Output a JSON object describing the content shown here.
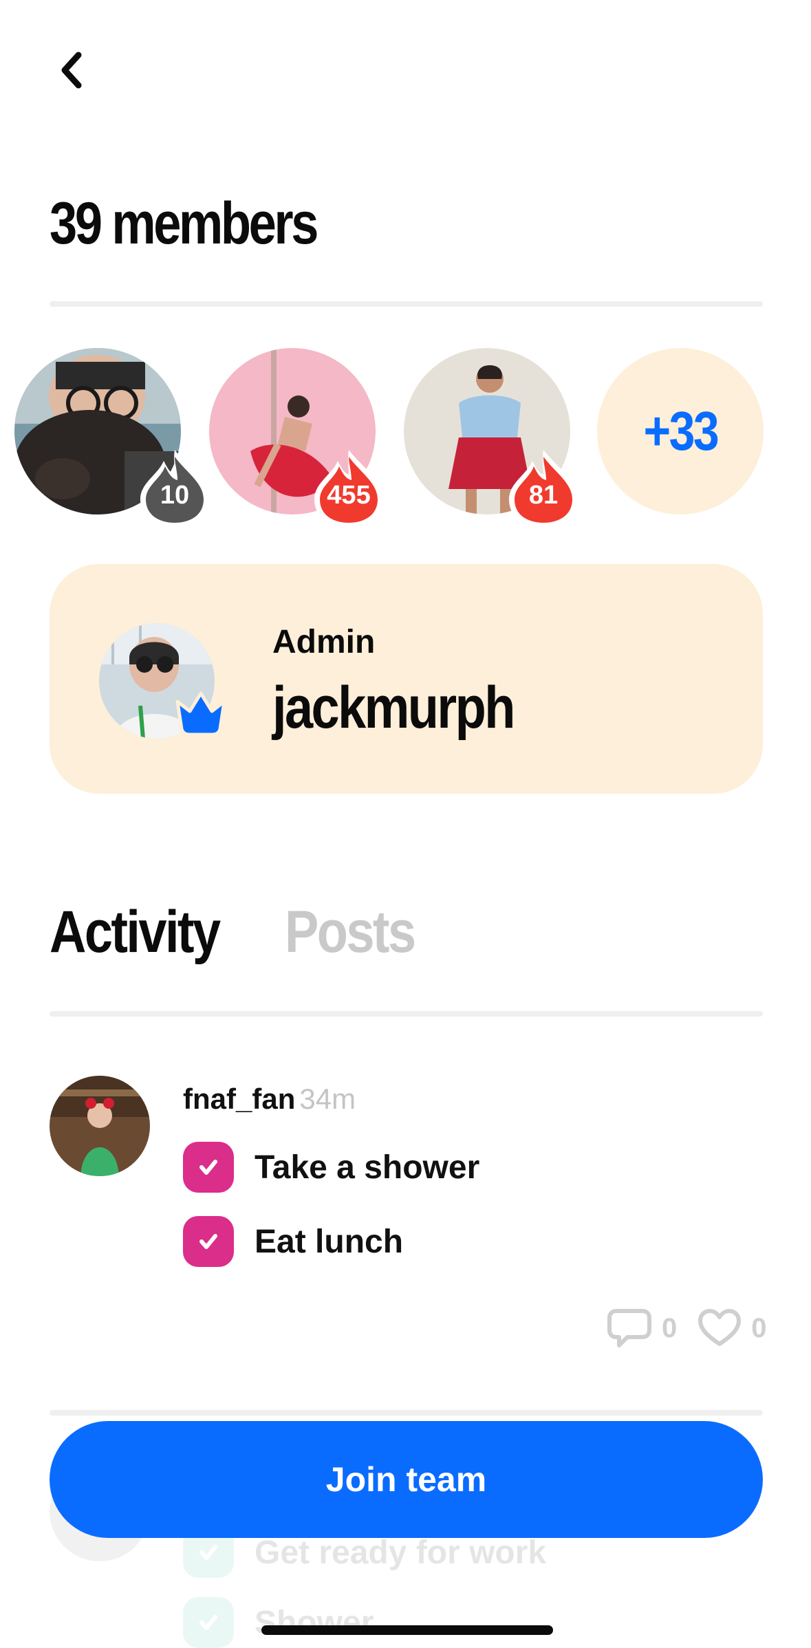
{
  "header": {
    "back_icon": "chevron-left-icon",
    "members_title": "39 members"
  },
  "members": {
    "avatars": [
      {
        "streak": "10",
        "streak_color": "#555555",
        "image": "person-with-dog"
      },
      {
        "streak": "455",
        "streak_color": "#f03a2e",
        "image": "pole-dancer"
      },
      {
        "streak": "81",
        "streak_color": "#f03a2e",
        "image": "person-in-red-skirt"
      }
    ],
    "more_count": "+33",
    "more_color": "#0a6cff"
  },
  "admin": {
    "label": "Admin",
    "username": "jackmurph",
    "badge_icon": "crown-icon",
    "card_color": "#fdefd9"
  },
  "tabs": [
    {
      "label": "Activity",
      "active": true
    },
    {
      "label": "Posts",
      "active": false
    }
  ],
  "feed": [
    {
      "username": "fnaf_fan",
      "time": "34m",
      "tasks": [
        "Take a shower",
        "Eat lunch"
      ],
      "comment_count": "0",
      "like_count": "0"
    },
    {
      "username": "",
      "time": "",
      "tasks": [
        "Get ready for work",
        "Shower"
      ]
    }
  ],
  "footer": {
    "join_label": "Join team",
    "accent": "#0a6cff"
  }
}
